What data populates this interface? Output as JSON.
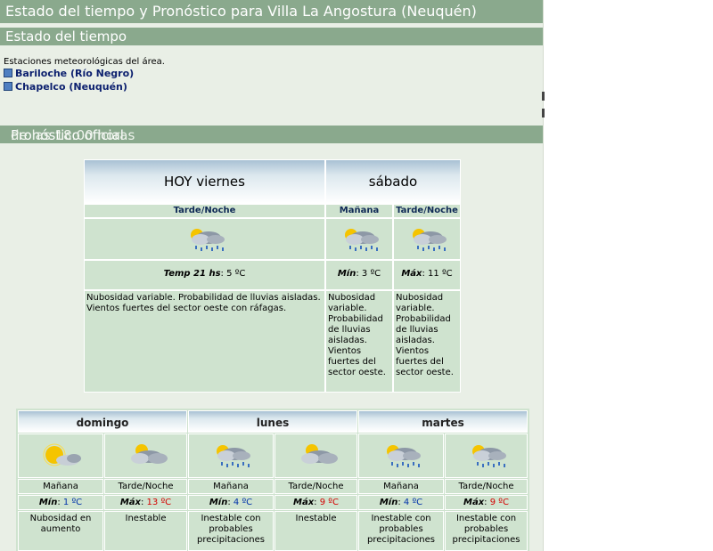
{
  "header": {
    "title": "Estado del tiempo y Pronóstico para Villa La Angostura (Neuquén)",
    "section_current": "Estado del tiempo",
    "forecast_title": "Pronóstico oficial",
    "forecast_time": "de las 18:00 horas"
  },
  "stations": {
    "intro": "Estaciones meteorológicas del área.",
    "items": [
      {
        "label": "Bariloche (Río Negro)"
      },
      {
        "label": "Chapelco (Neuquén)"
      }
    ]
  },
  "forecast_top": {
    "today": {
      "day": "HOY viernes",
      "period": "Tarde/Noche",
      "icon": "cloud-sun-rain-icon",
      "temp_label": "Temp 21 hs",
      "temp_value": "5 ºC",
      "description": "Nubosidad variable. Probabilidad de lluvias aisladas. Vientos fuertes del sector oeste con ráfagas."
    },
    "saturday": {
      "day": "sábado",
      "morning": {
        "period": "Mañana",
        "icon": "cloud-sun-rain-icon",
        "temp_label": "Mín",
        "temp_value": "3 ºC",
        "description": "Nubosidad variable. Probabilidad de lluvias aisladas. Vientos fuertes del sector oeste."
      },
      "evening": {
        "period": "Tarde/Noche",
        "icon": "cloud-sun-rain-icon",
        "temp_label": "Máx",
        "temp_value": "11 ºC",
        "description": "Nubosidad variable. Probabilidad de lluvias aisladas. Vientos fuertes del sector oeste."
      }
    }
  },
  "forecast_extended": [
    {
      "day": "domingo",
      "slots": [
        {
          "period": "Mañana",
          "icon": "sun-cloud-icon",
          "temp_label": "Mín",
          "temp_value": "1 ºC",
          "temp_color": "#0033aa",
          "description": "Nubosidad en aumento"
        },
        {
          "period": "Tarde/Noche",
          "icon": "cloudy-sun-icon",
          "temp_label": "Máx",
          "temp_value": "13 ºC",
          "temp_color": "#d40000",
          "description": "Inestable"
        }
      ]
    },
    {
      "day": "lunes",
      "slots": [
        {
          "period": "Mañana",
          "icon": "cloud-sun-rain-icon",
          "temp_label": "Mín",
          "temp_value": "4 ºC",
          "temp_color": "#0033aa",
          "description": "Inestable con probables precipitaciones"
        },
        {
          "period": "Tarde/Noche",
          "icon": "cloudy-sun-icon",
          "temp_label": "Máx",
          "temp_value": "9 ºC",
          "temp_color": "#d40000",
          "description": "Inestable"
        }
      ]
    },
    {
      "day": "martes",
      "slots": [
        {
          "period": "Mañana",
          "icon": "cloud-sun-rain-icon",
          "temp_label": "Mín",
          "temp_value": "4 ºC",
          "temp_color": "#0033aa",
          "description": "Inestable con probables precipitaciones"
        },
        {
          "period": "Tarde/Noche",
          "icon": "cloud-sun-rain-icon",
          "temp_label": "Máx",
          "temp_value": "9 ºC",
          "temp_color": "#d40000",
          "description": "Inestable con probables precipitaciones"
        }
      ]
    }
  ]
}
